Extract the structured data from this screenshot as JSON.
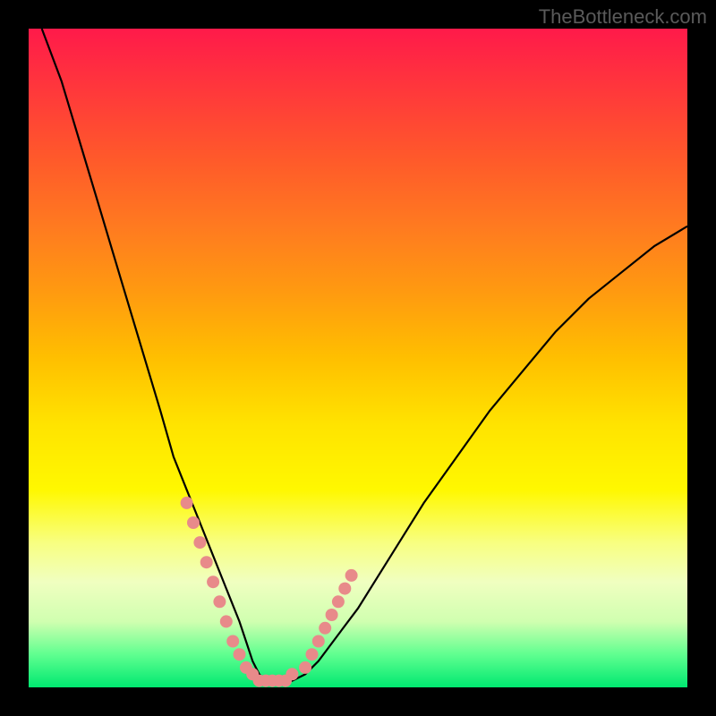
{
  "watermark": "TheBottleneck.com",
  "chart_data": {
    "type": "line",
    "title": "",
    "xlabel": "",
    "ylabel": "",
    "xlim": [
      0,
      100
    ],
    "ylim": [
      0,
      100
    ],
    "series": [
      {
        "name": "bottleneck-curve",
        "x": [
          2,
          5,
          8,
          11,
          14,
          17,
          20,
          22,
          24,
          26,
          28,
          30,
          32,
          33,
          34,
          35,
          36,
          38,
          40,
          42,
          44,
          47,
          50,
          55,
          60,
          65,
          70,
          75,
          80,
          85,
          90,
          95,
          100
        ],
        "values": [
          100,
          92,
          82,
          72,
          62,
          52,
          42,
          35,
          30,
          25,
          20,
          15,
          10,
          7,
          4,
          2,
          1,
          1,
          1,
          2,
          4,
          8,
          12,
          20,
          28,
          35,
          42,
          48,
          54,
          59,
          63,
          67,
          70
        ]
      }
    ],
    "highlight_points": {
      "name": "pink-markers",
      "color": "#e88a8a",
      "x": [
        24,
        25,
        26,
        27,
        28,
        29,
        30,
        31,
        32,
        33,
        34,
        35,
        36,
        37,
        38,
        39,
        40,
        42,
        43,
        44,
        45,
        46,
        47,
        48,
        49
      ],
      "values": [
        28,
        25,
        22,
        19,
        16,
        13,
        10,
        7,
        5,
        3,
        2,
        1,
        1,
        1,
        1,
        1,
        2,
        3,
        5,
        7,
        9,
        11,
        13,
        15,
        17
      ]
    },
    "gradient_stops": [
      {
        "pos": 0,
        "color": "#ff1a4a"
      },
      {
        "pos": 50,
        "color": "#ffbf00"
      },
      {
        "pos": 78,
        "color": "#f8ff80"
      },
      {
        "pos": 100,
        "color": "#00e870"
      }
    ]
  }
}
